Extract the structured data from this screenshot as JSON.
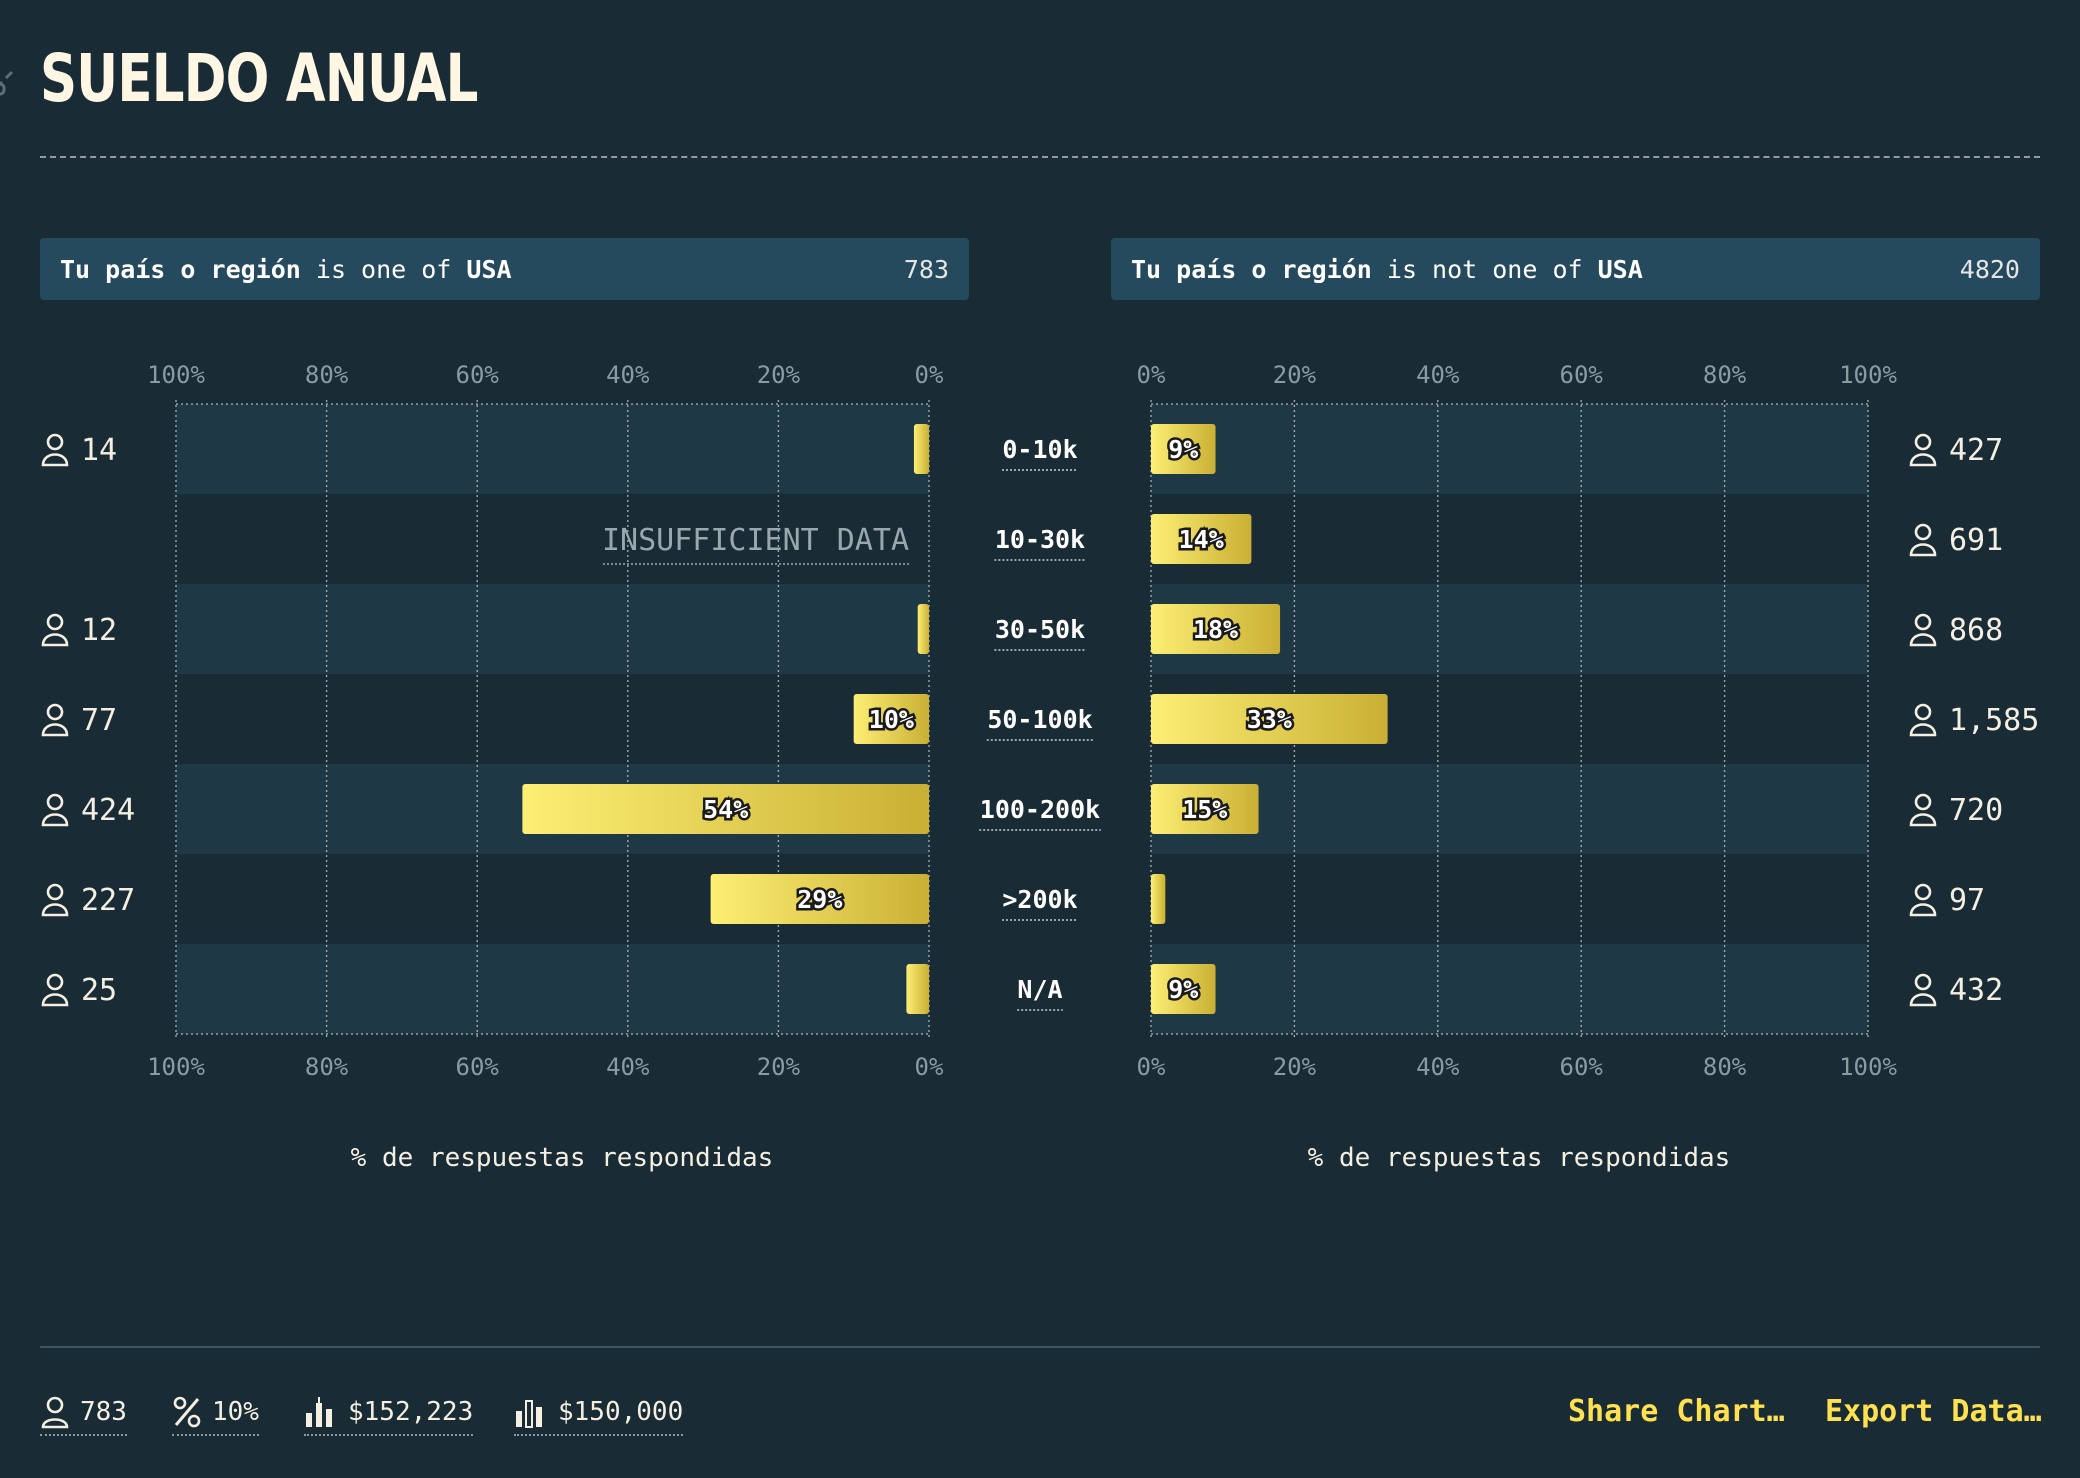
{
  "title": "SUELDO ANUAL",
  "filters": {
    "left": {
      "field": "Tu país o región",
      "op": "is one of",
      "value": "USA",
      "count": "783"
    },
    "right": {
      "field": "Tu país o región",
      "op": "is not one of",
      "value": "USA",
      "count": "4820"
    }
  },
  "insufficient_label": "INSUFFICIENT DATA",
  "footer": {
    "respondents": "783",
    "percent": "10%",
    "mean": "$152,223",
    "median": "$150,000",
    "share_label": "Share Chart…",
    "export_label": "Export Data…"
  },
  "colors": {
    "background": "#192b35",
    "band_dark": "#1f3845",
    "bar_light": "#fdef74",
    "bar_dark": "#c9b034",
    "link": "#ffe14f"
  },
  "icons": {
    "person": "person-icon",
    "percent": "percent-icon",
    "mean": "mean-bars-icon",
    "median": "median-bars-icon",
    "link": "link-icon"
  },
  "chart_data": {
    "type": "bar",
    "orientation": "horizontal-butterfly",
    "categories": [
      "0-10k",
      "10-30k",
      "30-50k",
      "50-100k",
      "100-200k",
      ">200k",
      "N/A"
    ],
    "x_ticks": [
      "100%",
      "80%",
      "60%",
      "40%",
      "20%",
      "0%"
    ],
    "x_ticks_right": [
      "0%",
      "20%",
      "40%",
      "60%",
      "80%",
      "100%"
    ],
    "xlabel": "% de respuestas respondidas",
    "xlim": [
      0,
      100
    ],
    "series": [
      {
        "name": "USA",
        "values": [
          2,
          null,
          1.5,
          10,
          54,
          29,
          3
        ],
        "labels": [
          "",
          "",
          "",
          "10%",
          "54%",
          "29%",
          ""
        ],
        "counts": [
          "14",
          "",
          "12",
          "77",
          "424",
          "227",
          "25"
        ],
        "insufficient": [
          false,
          true,
          false,
          false,
          false,
          false,
          false
        ]
      },
      {
        "name": "No USA",
        "values": [
          9,
          14,
          18,
          33,
          15,
          2,
          9
        ],
        "labels": [
          "9%",
          "14%",
          "18%",
          "33%",
          "15%",
          "",
          "9%"
        ],
        "counts": [
          "427",
          "691",
          "868",
          "1,585",
          "720",
          "97",
          "432"
        ],
        "insufficient": [
          false,
          false,
          false,
          false,
          false,
          false,
          false
        ]
      }
    ]
  }
}
